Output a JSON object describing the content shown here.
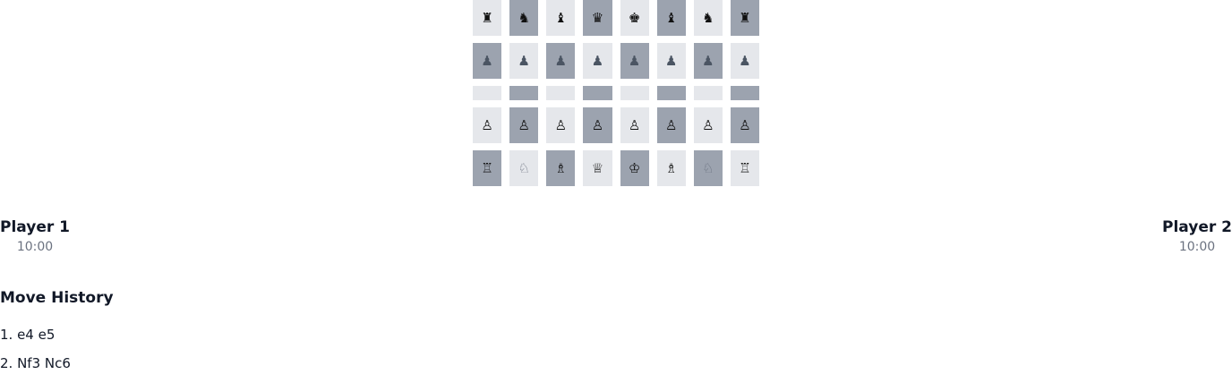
{
  "board": {
    "rows": [
      {
        "squares": [
          {
            "piece": "♜",
            "shade": "light",
            "color": "#111111"
          },
          {
            "piece": "♞",
            "shade": "dark",
            "color": "#111111"
          },
          {
            "piece": "♝",
            "shade": "light",
            "color": "#111111"
          },
          {
            "piece": "♛",
            "shade": "dark",
            "color": "#111111"
          },
          {
            "piece": "♚",
            "shade": "light",
            "color": "#111111"
          },
          {
            "piece": "♝",
            "shade": "dark",
            "color": "#111111"
          },
          {
            "piece": "♞",
            "shade": "light",
            "color": "#111111"
          },
          {
            "piece": "♜",
            "shade": "dark",
            "color": "#111111"
          }
        ]
      },
      {
        "squares": [
          {
            "piece": "♟",
            "shade": "dark",
            "color": "#4b5563"
          },
          {
            "piece": "♟",
            "shade": "light",
            "color": "#4b5563"
          },
          {
            "piece": "♟",
            "shade": "dark",
            "color": "#4b5563"
          },
          {
            "piece": "♟",
            "shade": "light",
            "color": "#4b5563"
          },
          {
            "piece": "♟",
            "shade": "dark",
            "color": "#4b5563"
          },
          {
            "piece": "♟",
            "shade": "light",
            "color": "#4b5563"
          },
          {
            "piece": "♟",
            "shade": "dark",
            "color": "#4b5563"
          },
          {
            "piece": "♟",
            "shade": "light",
            "color": "#4b5563"
          }
        ]
      },
      {
        "squares": [
          {
            "piece": "",
            "shade": "light",
            "color": "#111111"
          },
          {
            "piece": "",
            "shade": "dark",
            "color": "#111111"
          },
          {
            "piece": "",
            "shade": "light",
            "color": "#111111"
          },
          {
            "piece": "",
            "shade": "dark",
            "color": "#111111"
          },
          {
            "piece": "",
            "shade": "light",
            "color": "#111111"
          },
          {
            "piece": "",
            "shade": "dark",
            "color": "#111111"
          },
          {
            "piece": "",
            "shade": "light",
            "color": "#111111"
          },
          {
            "piece": "",
            "shade": "dark",
            "color": "#111111"
          }
        ]
      },
      {
        "squares": [
          {
            "piece": "♙",
            "shade": "light",
            "color": "#111111"
          },
          {
            "piece": "♙",
            "shade": "dark",
            "color": "#111111"
          },
          {
            "piece": "♙",
            "shade": "light",
            "color": "#111111"
          },
          {
            "piece": "♙",
            "shade": "dark",
            "color": "#111111"
          },
          {
            "piece": "♙",
            "shade": "light",
            "color": "#111111"
          },
          {
            "piece": "♙",
            "shade": "dark",
            "color": "#111111"
          },
          {
            "piece": "♙",
            "shade": "light",
            "color": "#111111"
          },
          {
            "piece": "♙",
            "shade": "dark",
            "color": "#111111"
          }
        ]
      },
      {
        "squares": [
          {
            "piece": "♖",
            "shade": "dark",
            "color": "#111111"
          },
          {
            "piece": "♘",
            "shade": "light",
            "color": "#6b7280"
          },
          {
            "piece": "♗",
            "shade": "dark",
            "color": "#111111"
          },
          {
            "piece": "♕",
            "shade": "light",
            "color": "#111111"
          },
          {
            "piece": "♔",
            "shade": "dark",
            "color": "#111111"
          },
          {
            "piece": "♗",
            "shade": "light",
            "color": "#111111"
          },
          {
            "piece": "♘",
            "shade": "dark",
            "color": "#6b7280"
          },
          {
            "piece": "♖",
            "shade": "light",
            "color": "#111111"
          }
        ]
      }
    ]
  },
  "players": {
    "p1": {
      "name": "Player 1",
      "clock": "10:00"
    },
    "p2": {
      "name": "Player 2",
      "clock": "10:00"
    }
  },
  "history": {
    "title": "Move History",
    "moves": [
      "1. e4 e5",
      "2. Nf3 Nc6"
    ]
  }
}
